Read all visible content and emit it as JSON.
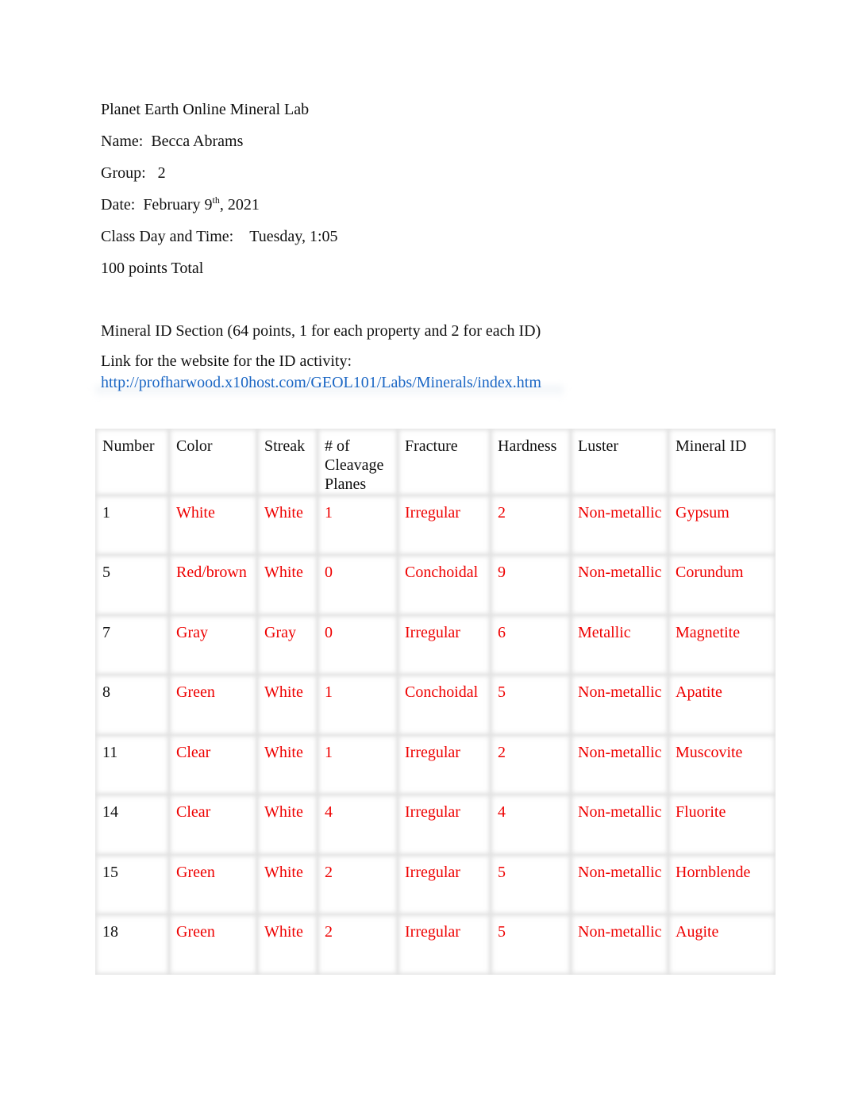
{
  "document": {
    "title": "Planet Earth Online Mineral Lab",
    "name_label": "Name:",
    "name_value": "Becca Abrams",
    "group_label": "Group:",
    "group_value": "2",
    "date_label": "Date:",
    "date_month_day": "February 9",
    "date_suffix": "th",
    "date_year": ", 2021",
    "class_label": "Class Day and Time:",
    "class_value": "Tuesday, 1:05",
    "points_total": "100 points Total",
    "section_heading": "Mineral ID Section (64 points, 1 for each property and 2 for each ID)",
    "link_intro": "Link for the website for the ID activity:",
    "link_text": "http://profharwood.x10host.com/GEOL101/Labs/Minerals/index.htm"
  },
  "colors": {
    "answer_text": "#ee0000",
    "link": "#1a66c4"
  },
  "table": {
    "headers": [
      "Number",
      "Color",
      "Streak",
      "# of Cleavage Planes",
      "Fracture",
      "Hardness",
      "Luster",
      "Mineral ID"
    ],
    "rows": [
      [
        "1",
        "White",
        "White",
        "1",
        "Irregular",
        "2",
        "Non-metallic",
        "Gypsum"
      ],
      [
        "5",
        "Red/brown",
        "White",
        "0",
        "Conchoidal",
        "9",
        "Non-metallic",
        "Corundum"
      ],
      [
        "7",
        "Gray",
        "Gray",
        "0",
        "Irregular",
        "6",
        "Metallic",
        "Magnetite"
      ],
      [
        "8",
        "Green",
        "White",
        "1",
        "Conchoidal",
        "5",
        "Non-metallic",
        "Apatite"
      ],
      [
        "11",
        "Clear",
        "White",
        "1",
        "Irregular",
        "2",
        "Non-metallic",
        "Muscovite"
      ],
      [
        "14",
        "Clear",
        "White",
        "4",
        "Irregular",
        "4",
        "Non-metallic",
        "Fluorite"
      ],
      [
        "15",
        "Green",
        "White",
        "2",
        "Irregular",
        "5",
        "Non-metallic",
        "Hornblende"
      ],
      [
        "18",
        "Green",
        "White",
        "2",
        "Irregular",
        "5",
        "Non-metallic",
        "Augite"
      ]
    ]
  }
}
